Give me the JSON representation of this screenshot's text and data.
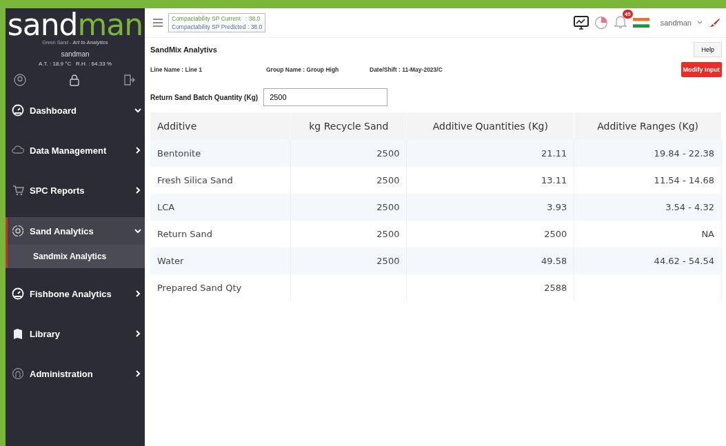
{
  "brand": {
    "logo_light": "sand",
    "logo_accent": "man",
    "tagline": "Green Sand - ",
    "tagline_em": "Art to Analytics"
  },
  "user": {
    "name": "sandman",
    "readings": "A.T. : 18.9 °C   R.H. : 64.33 %"
  },
  "sidebar": {
    "items": [
      {
        "label": "Dashboard",
        "expanded": true,
        "selected": false
      },
      {
        "label": "Data Management",
        "expanded": false,
        "selected": false
      },
      {
        "label": "SPC Reports",
        "expanded": false,
        "selected": false
      },
      {
        "label": "Sand Analytics",
        "expanded": true,
        "selected": true,
        "children": [
          {
            "label": "Sandmix Analytics",
            "selected": true
          }
        ]
      },
      {
        "label": "Fishbone Analytics",
        "expanded": false,
        "selected": false
      },
      {
        "label": "Library",
        "expanded": false,
        "selected": false
      },
      {
        "label": "Administration",
        "expanded": false,
        "selected": false
      }
    ]
  },
  "topbar": {
    "sp_current": "Compactability SP Current   : 38.0",
    "sp_predicted": "Compactability SP Predicted : 38.0",
    "notifications": "45",
    "user": "sandman"
  },
  "page": {
    "title": "SandMix Analytivs",
    "help": "Help",
    "line": "Line Name : Line 1",
    "group": "Group Name : Group High",
    "date": "Date/Shift : 11-May-2023/C",
    "modify": "Modify Input",
    "batch_label": "Return Sand Batch Quantity (Kg)",
    "batch_value": "2500"
  },
  "table": {
    "columns": [
      "Additive",
      "kg Recycle Sand",
      "Additive Quantities (Kg)",
      "Additive Ranges (Kg)"
    ],
    "rows": [
      [
        "Bentonite",
        "2500",
        "21.11",
        "19.84 - 22.38"
      ],
      [
        "Fresh Silica Sand",
        "2500",
        "13.11",
        "11.54 - 14.68"
      ],
      [
        "LCA",
        "2500",
        "3.93",
        "3.54 - 4.32"
      ],
      [
        "Return Sand",
        "2500",
        "2500",
        "NA"
      ],
      [
        "Water",
        "2500",
        "49.58",
        "44.62 - 54.54"
      ],
      [
        "Prepared Sand Qty",
        "",
        "2588",
        ""
      ]
    ]
  }
}
